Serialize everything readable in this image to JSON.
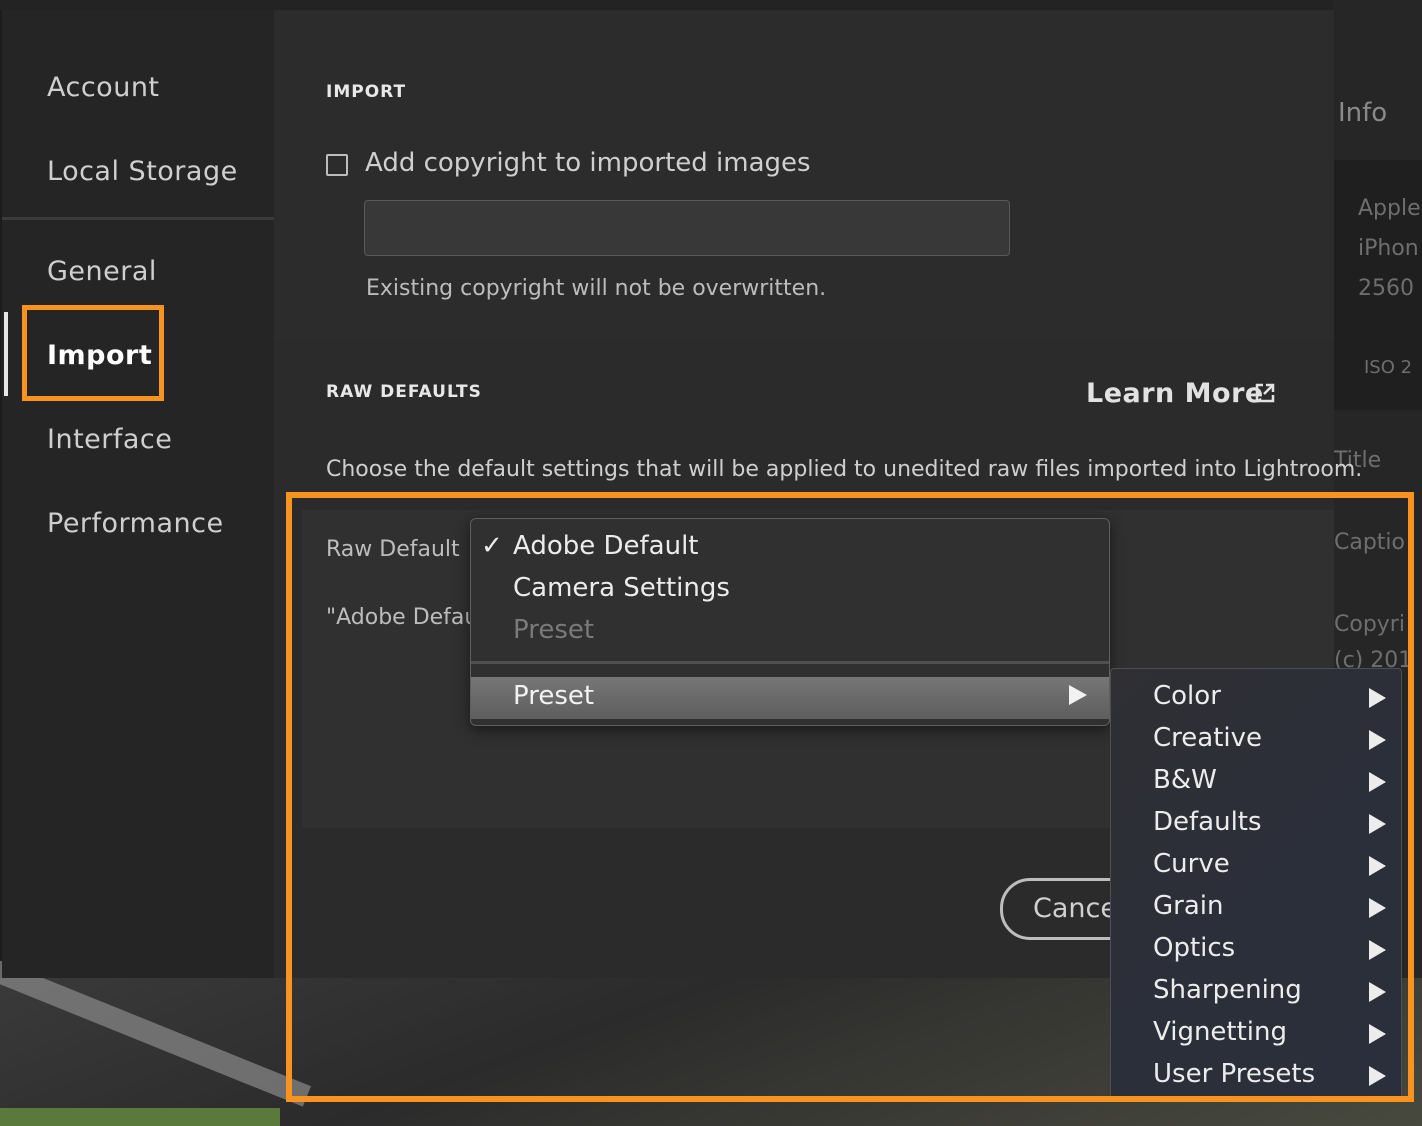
{
  "background": {
    "info_label": "Info",
    "right_panel_texts": [
      "Apple",
      "iPhon",
      "2560",
      "ISO 2",
      "Title",
      "Captio",
      "Copyri",
      "(c) 201"
    ]
  },
  "sidebar": {
    "items": [
      {
        "label": "Account"
      },
      {
        "label": "Local Storage"
      },
      {
        "label": "General"
      },
      {
        "label": "Import"
      },
      {
        "label": "Interface"
      },
      {
        "label": "Performance"
      }
    ],
    "active": "Import"
  },
  "import_section": {
    "title": "IMPORT",
    "copyright_checkbox_label": "Add copyright to imported images",
    "copyright_checked": false,
    "copyright_value": "",
    "note": "Existing copyright will not be overwritten."
  },
  "raw_defaults": {
    "title": "RAW DEFAULTS",
    "learn_more": "Learn More",
    "description": "Choose the default settings that will be applied to unedited raw files imported into Lightroom.",
    "raw_default_label": "Raw Default",
    "adobe_default_text": "\"Adobe Default",
    "cancel_label": "Cancel"
  },
  "dropdown": {
    "checkmark": "✓",
    "items": [
      {
        "label": "Adobe Default",
        "selected": true
      },
      {
        "label": "Camera Settings"
      },
      {
        "label": "Preset",
        "disabled": true
      }
    ],
    "submenu_trigger": "Preset"
  },
  "submenu": {
    "items": [
      "Color",
      "Creative",
      "B&W",
      "Defaults",
      "Curve",
      "Grain",
      "Optics",
      "Sharpening",
      "Vignetting",
      "User Presets"
    ]
  },
  "colors": {
    "highlight": "#f7931e",
    "dialog_bg": "#2b2b2b",
    "sidebar_bg": "#252525"
  }
}
